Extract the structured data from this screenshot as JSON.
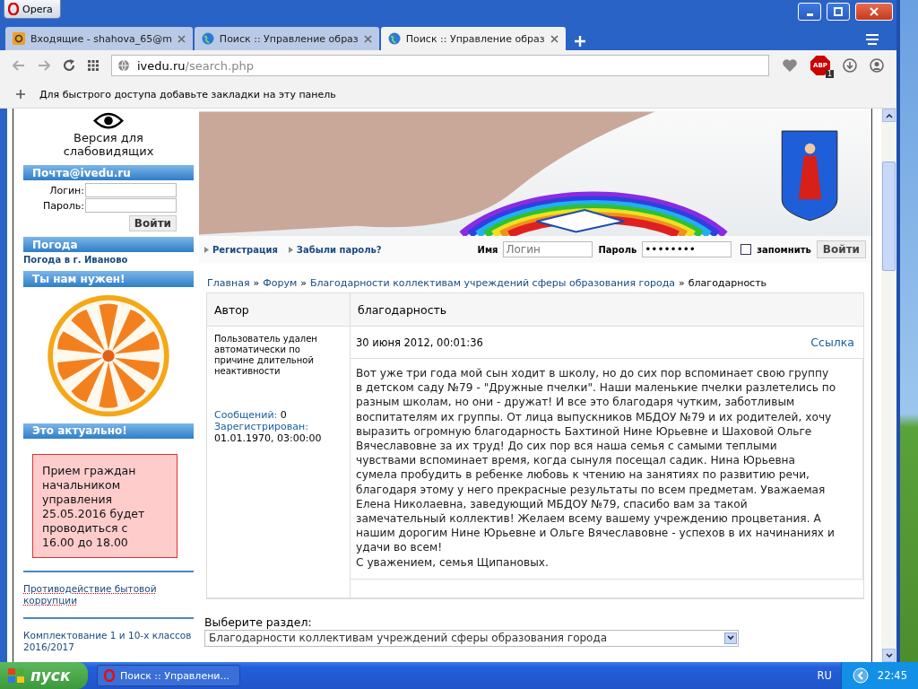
{
  "browser": {
    "app_button": "Opera",
    "tabs": [
      {
        "title": "Входящие - shahova_65@m",
        "kind": "mail",
        "selected": false
      },
      {
        "title": "Поиск :: Управление образ",
        "kind": "globe",
        "selected": false
      },
      {
        "title": "Поиск :: Управление образ",
        "kind": "globe",
        "selected": true
      }
    ],
    "address": {
      "host": "ivedu.ru",
      "path": "/search.php"
    },
    "adblock": {
      "label": "ABP",
      "count": "1"
    },
    "bookmarks_hint": "Для быстрого доступа добавьте закладки на эту панель"
  },
  "sidebar": {
    "accessibility_label": "Версия для слабовидящих",
    "mail": {
      "title": "Почта@ivedu.ru",
      "login_label": "Логин:",
      "password_label": "Пароль:",
      "button": "Войти"
    },
    "weather": {
      "title": "Погода",
      "link": "Погода в г. Иваново"
    },
    "need": {
      "title": "Ты нам нужен!"
    },
    "actual": {
      "title": "Это актуально!",
      "notice": "Прием граждан начальником управления 25.05.2016 будет проводиться с 16.00 до 18.00"
    },
    "links": [
      "Противодействие бытовой коррупции",
      "Комплектование 1 и 10-х классов 2016/2017"
    ]
  },
  "login_bar": {
    "links": [
      "Регистрация",
      "Забыли пароль?"
    ],
    "name_label": "Имя",
    "login_placeholder": "Логин",
    "password_label": "Пароль",
    "password_value": "••••••••",
    "remember": {
      "label": "запомнить",
      "checked": false
    },
    "button": "Войти"
  },
  "breadcrumbs": [
    {
      "label": "Главная",
      "kind": "link"
    },
    {
      "separator": "»",
      "label": "Форум",
      "kind": "link"
    },
    {
      "separator": "»",
      "label": "Благодарности коллективам учреждений сферы образования города",
      "kind": "link"
    },
    {
      "separator": "»",
      "label": "благодарность",
      "kind": "current"
    }
  ],
  "post": {
    "author_heading": "Автор",
    "topic": "благодарность",
    "author": "Пользователь удален автоматически по причине длительной неактивности",
    "stats": [
      {
        "label": "Сообщений:",
        "value": "0"
      },
      {
        "label": "Зарегистрирован:",
        "value": "01.01.1970, 03:00:00"
      }
    ],
    "date": "30 июня 2012, 00:01:36",
    "link": "Ссылка",
    "body": "Вот уже три года мой сын ходит в школу, но до сих пор вспоминает свою группу\nв детском саду №79 - \"Дружные пчелки\". Наши маленькие пчелки разлетелись по\nразным школам, но они - дружат! И все это благодаря чутким, заботливым\nвоспитателям их группы. От лица выпускников МБДОУ №79 и их родителей, хочу\nвыразить огромную благодарность Бахтиной Нине Юрьевне и Шаховой Ольге\nВячеславовне за их труд! До сих пор вся наша семья с самыми теплыми\nчувствами вспоминает время, когда сынуля посещал садик. Нина Юрьевна\nсумела пробудить в ребенке любовь к чтению на занятиях по развитию речи,\nблагодаря этому у него прекрасные результаты по всем предметам. Уважаемая\nЕлена Николаевна, заведующий МБДОУ №79, спасибо вам за такой\nзамечательный коллектив! Желаем всему вашему учреждению процветания. А\nнашим дорогим Нине Юрьевне и Ольге Вячеславовне - успехов в их начинаниях и\nудачи во всем!\nС уважением, семья Щипановых."
  },
  "section_select": {
    "label": "Выберите раздел:",
    "value": "Благодарности коллективам учреждений сферы образования города"
  },
  "taskbar": {
    "start": "пуск",
    "tasks": [
      {
        "title": "Поиск :: Управлени...",
        "selected": false
      }
    ],
    "language": "RU",
    "clock": "22:45"
  }
}
